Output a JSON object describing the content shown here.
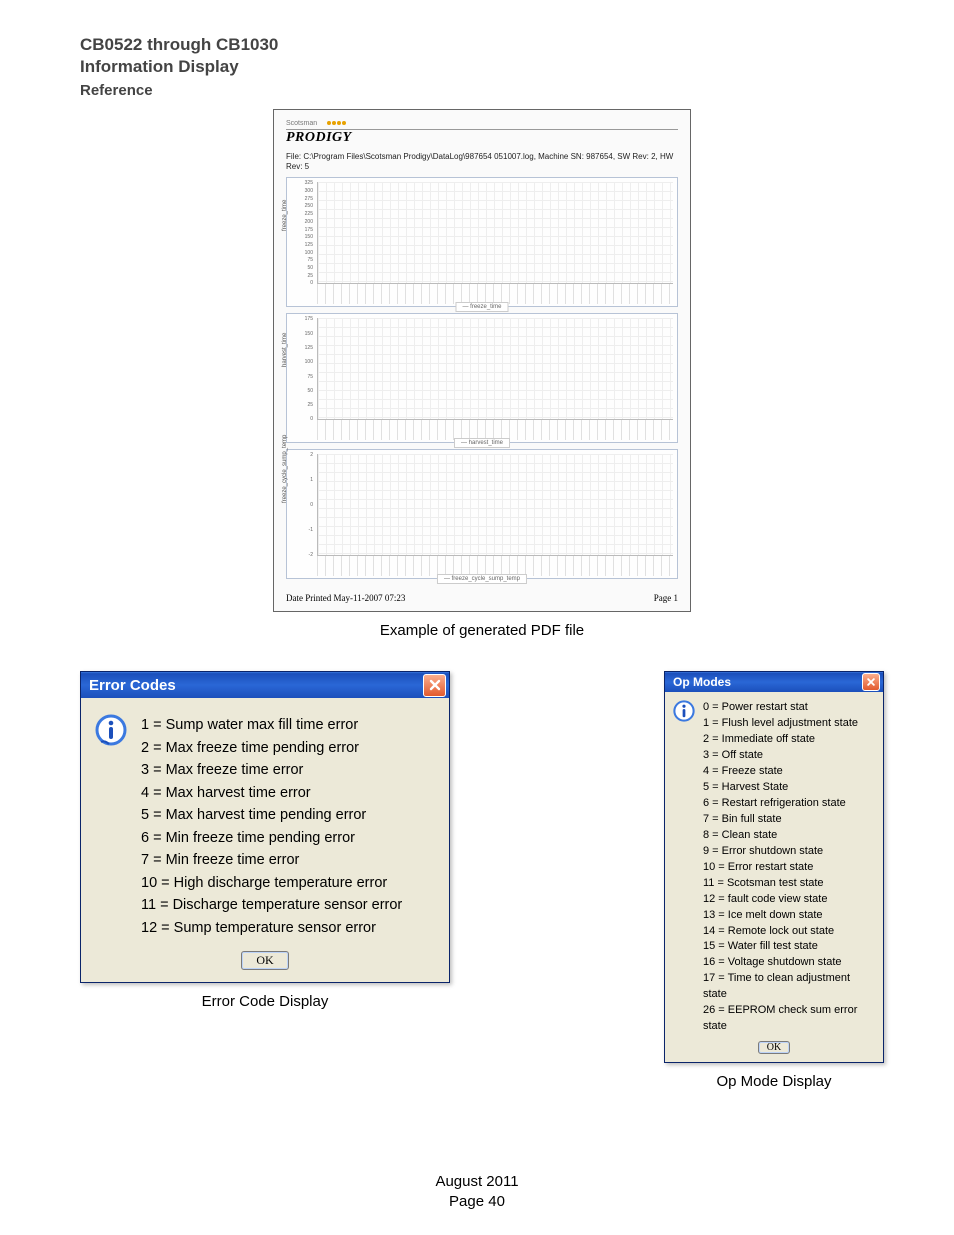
{
  "header": {
    "title_line1": "CB0522 through CB1030",
    "title_line2": "Information Display",
    "reference": "Reference"
  },
  "pdf": {
    "brand_small": "Scotsman",
    "brand": "PRODIGY",
    "file_line": "File: C:\\Program Files\\Scotsman Prodigy\\DataLog\\987654 051007.log, Machine SN: 987654,  SW Rev: 2,  HW Rev: 5",
    "printed": "Date Printed May-11-2007 07:23",
    "page": "Page 1",
    "caption": "Example of generated PDF file"
  },
  "chart_data": [
    {
      "type": "line",
      "title": "",
      "xlabel": "",
      "ylabel": "freeze_time",
      "y_ticks": [
        "325",
        "300",
        "275",
        "250",
        "225",
        "200",
        "175",
        "150",
        "125",
        "100",
        "75",
        "50",
        "25",
        "0"
      ],
      "ylim": [
        0,
        325
      ],
      "legend": "freeze_time",
      "note": "x-axis is dense date/time tick labels (unreadable at this resolution)",
      "series": [
        {
          "name": "freeze_time",
          "values": []
        }
      ]
    },
    {
      "type": "line",
      "title": "",
      "xlabel": "",
      "ylabel": "harvest_time",
      "y_ticks": [
        "175",
        "150",
        "125",
        "100",
        "75",
        "50",
        "25",
        "0"
      ],
      "ylim": [
        0,
        175
      ],
      "legend": "harvest_time",
      "series": [
        {
          "name": "harvest_time",
          "values": []
        }
      ]
    },
    {
      "type": "line",
      "title": "",
      "xlabel": "",
      "ylabel": "freeze_cycle_sump_temp",
      "y_ticks": [
        "2",
        "1",
        "0",
        "-1",
        "-2"
      ],
      "ylim": [
        -2,
        2
      ],
      "legend": "freeze_cycle_sump_temp",
      "series": [
        {
          "name": "freeze_cycle_sump_temp",
          "values": []
        }
      ]
    }
  ],
  "error_dialog": {
    "title": "Error Codes",
    "ok": "OK",
    "caption": "Error Code Display",
    "items": [
      "1 = Sump water max fill time error",
      "2 = Max freeze time pending error",
      "3 = Max freeze time error",
      "4 = Max harvest time error",
      "5 = Max harvest time pending error",
      "6 = Min freeze time pending error",
      "7 = Min freeze time error",
      "10 = High discharge temperature error",
      "11 = Discharge temperature sensor error",
      "12 = Sump temperature sensor error"
    ]
  },
  "op_dialog": {
    "title": "Op Modes",
    "ok": "OK",
    "caption": "Op Mode Display",
    "items": [
      "0 = Power restart stat",
      "1 = Flush level adjustment state",
      "2 = Immediate off state",
      "3 = Off state",
      "4 = Freeze state",
      "5 = Harvest State",
      "6 = Restart refrigeration state",
      "7 = Bin full state",
      "8 = Clean state",
      "9 = Error shutdown state",
      "10 = Error restart state",
      "11 = Scotsman test state",
      "12 = fault code view state",
      "13 = Ice melt down state",
      "14 = Remote lock out state",
      "15 = Water fill test state",
      "16 = Voltage shutdown state",
      "17 = Time to clean adjustment state",
      "26 = EEPROM check sum error state"
    ]
  },
  "footer": {
    "date": "August 2011",
    "page": "Page 40"
  }
}
